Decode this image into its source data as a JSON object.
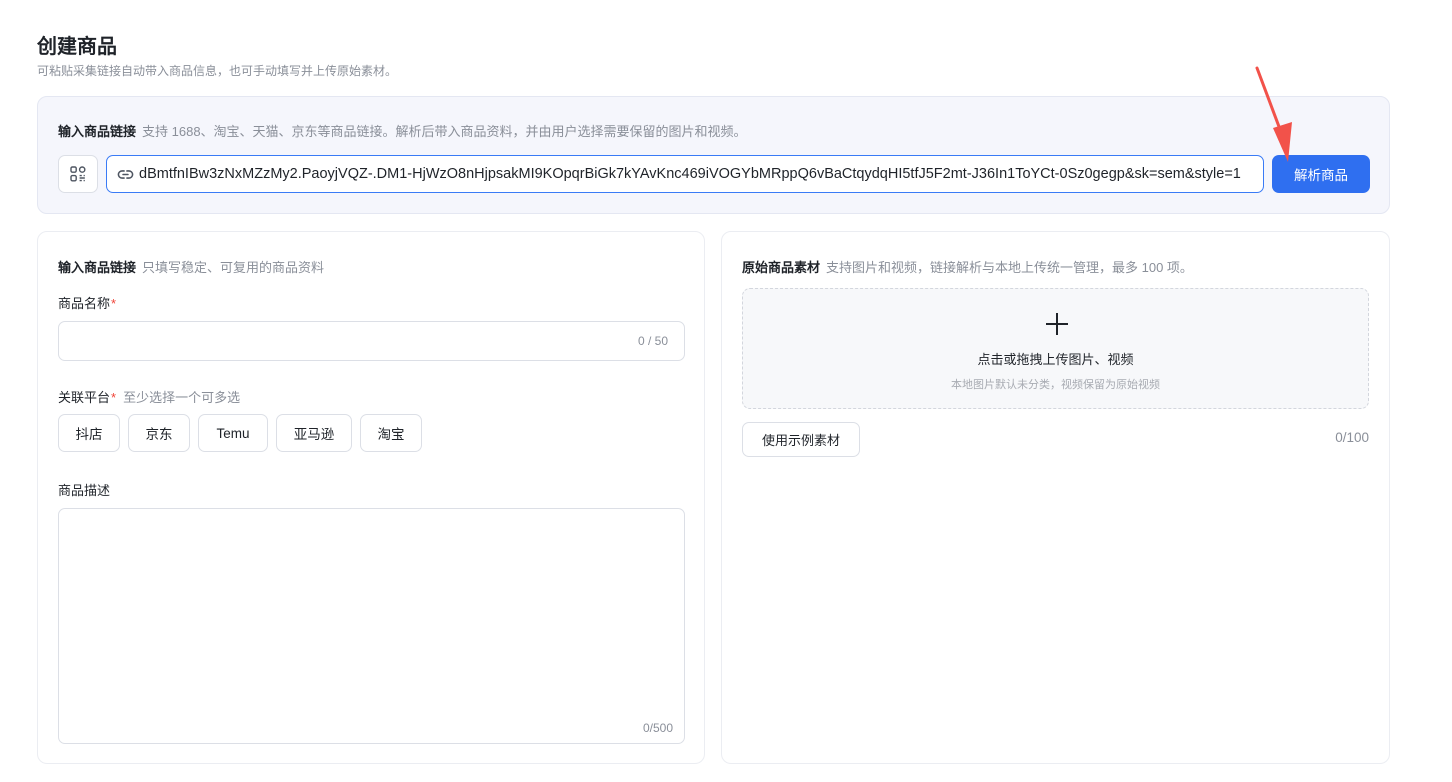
{
  "header": {
    "title": "创建商品",
    "subtitle": "可粘贴采集链接自动带入商品信息，也可手动填写并上传原始素材。"
  },
  "link_panel": {
    "label": "输入商品链接",
    "hint": "支持 1688、淘宝、天猫、京东等商品链接。解析后带入商品资料，并由用户选择需要保留的图片和视频。",
    "url_value": "dBmtfnIBw3zNxMZzMy2.PaoyjVQZ-.DM1-HjWzO8nHjpsakMI9KOpqrBiGk7kYAvKnc469iVOGYbMRppQ6vBaCtqydqHI5tfJ5F2mt-J36In1ToYCt-0Sz0gegp&sk=sem&style=1",
    "parse_button": "解析商品",
    "qr_icon": "qr-code-icon",
    "link_icon": "link-icon"
  },
  "product_form": {
    "section_label": "输入商品链接",
    "section_hint": "只填写稳定、可复用的商品资料",
    "name_label": "商品名称",
    "required_mark": "*",
    "name_counter": "0 / 50",
    "platform_label": "关联平台",
    "platform_hint": "至少选择一个可多选",
    "platforms": [
      "抖店",
      "京东",
      "Temu",
      "亚马逊",
      "淘宝"
    ],
    "description_label": "商品描述",
    "description_counter": "0/500"
  },
  "assets": {
    "section_label": "原始商品素材",
    "section_hint": "支持图片和视频，链接解析与本地上传统一管理，最多 100 项。",
    "upload_main": "点击或拖拽上传图片、视频",
    "upload_sub": "本地图片默认未分类，视频保留为原始视频",
    "upload_icon": "plus-icon",
    "sample_button": "使用示例素材",
    "counter": "0/100"
  },
  "colors": {
    "accent": "#2f6ff0",
    "annotation_arrow": "#f2524a",
    "required": "#f04438",
    "panel_bg": "#f5f6fc"
  }
}
